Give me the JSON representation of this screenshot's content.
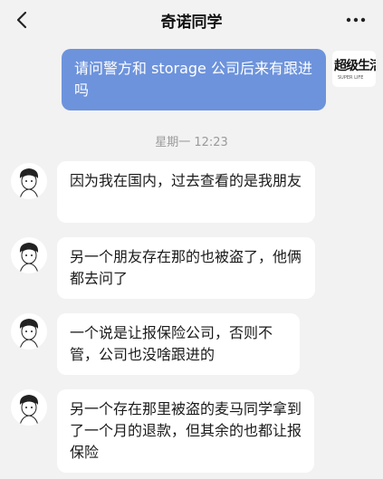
{
  "header": {
    "title": "奇诺同学"
  },
  "messages": {
    "outgoing": [
      {
        "text": "请问警方和 storage 公司后来有跟进吗"
      }
    ],
    "timestamp": "星期一 12:23",
    "incoming": [
      {
        "text": "因为我在国内，过去查看的是我朋友"
      },
      {
        "text": "另一个朋友存在那的也被盗了，他俩都去问了"
      },
      {
        "text": "一个说是让报保险公司，否则不管，公司也没啥跟进的"
      },
      {
        "text": "另一个存在那里被盗的麦马同学拿到了一个月的退款，但其余的也都让报保险"
      }
    ]
  },
  "self_avatar": {
    "logo_text": "超级生活",
    "logo_sub": "SUPER LIFE"
  },
  "icons": {
    "back": "chevron-left-icon",
    "more": "more-dots-icon"
  }
}
